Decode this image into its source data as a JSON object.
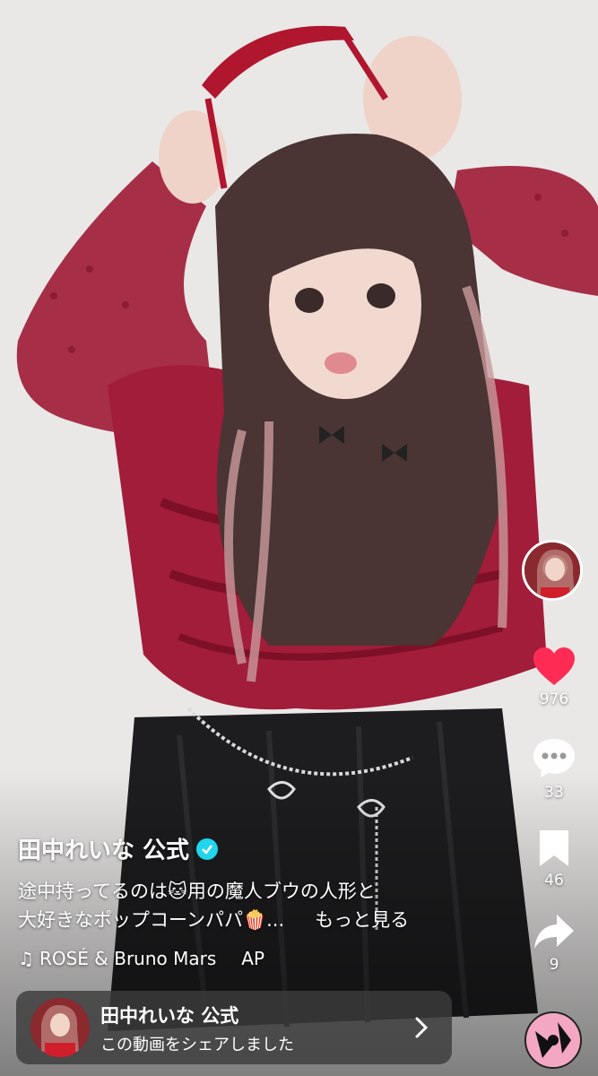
{
  "author": {
    "name": "田中れいな 公式"
  },
  "caption": {
    "line1": "途中持ってるのは🐱用の魔人ブウの人形と",
    "line2": "大好きなポップコーンパパ🍿...",
    "more": "もっと見る"
  },
  "music": {
    "note": "♫",
    "title": "ROSÉ & Bruno Mars",
    "trail": "AP"
  },
  "actions": {
    "likes": "976",
    "comments": "33",
    "bookmarks": "46",
    "shares": "9"
  },
  "share_card": {
    "name": "田中れいな 公式",
    "subtitle": "この動画をシェアしました"
  },
  "colors": {
    "like": "#fe2c55",
    "verified": "#20d5ec",
    "blouse": "#a11d3a",
    "skirt": "#1d1d1f"
  }
}
